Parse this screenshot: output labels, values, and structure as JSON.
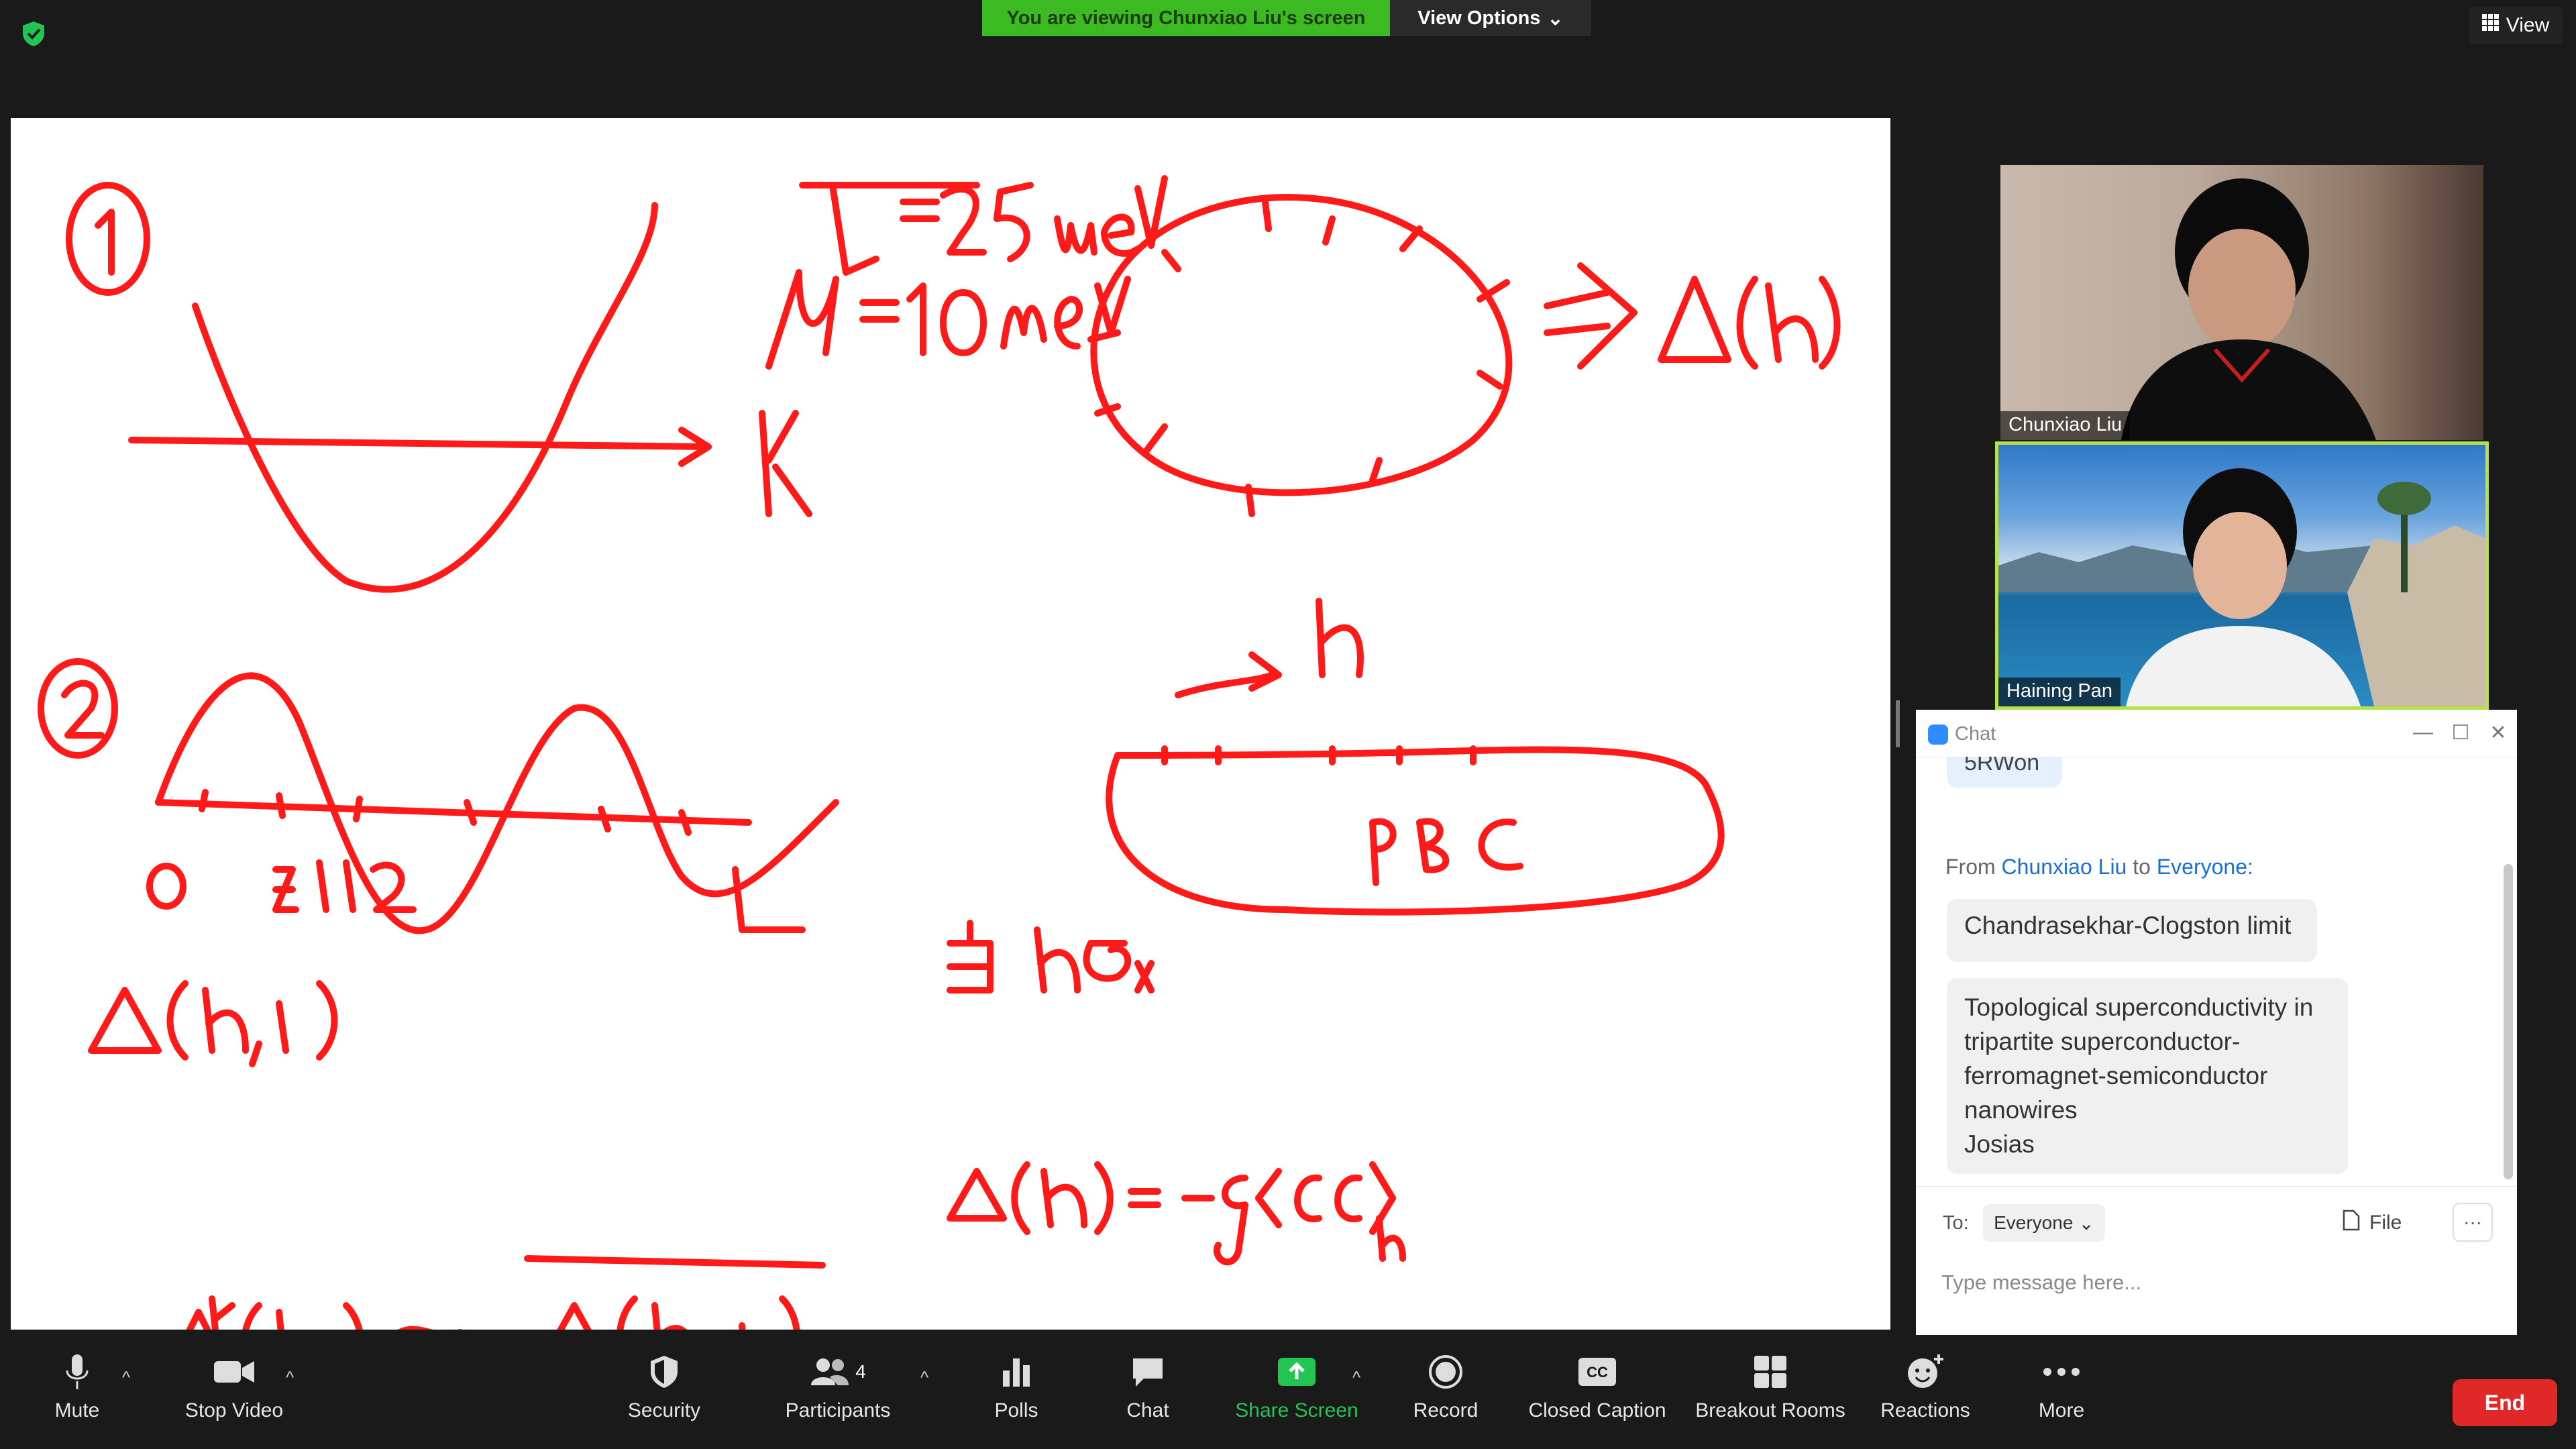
{
  "banner": {
    "viewing_text": "You are viewing Chunxiao Liu's screen",
    "view_options_label": "View Options",
    "view_label": "View"
  },
  "whiteboard": {
    "ink_color": "#ff1a1a",
    "strokes_text": [
      "①",
      "t=25 meV",
      "μ=10 meV",
      "k",
      "⇒ Δ(h)",
      "②",
      "h",
      "PBC",
      "0",
      "i=1",
      "i=2",
      "L",
      "Δ(h,i)",
      "当 hσx",
      "Δ(h)=-g⟨cc⟩h",
      "Δ(h) = Δ(h,i)",
      "k"
    ]
  },
  "participants_video": [
    {
      "name": "Chunxiao Liu"
    },
    {
      "name": "Haining Pan",
      "active_speaker": true
    }
  ],
  "chat": {
    "title": "Chat",
    "prev_bubble": "5RWon",
    "from_prefix": "From",
    "from_name": "Chunxiao Liu",
    "to_word": "to",
    "to_name": "Everyone:",
    "messages": [
      "Chandrasekhar-Clogston limit",
      "Topological superconductivity in tripartite superconductor-ferromagnet-semiconductor nanowires\nJosias"
    ],
    "to_label": "To:",
    "recipient": "Everyone",
    "file_label": "File",
    "input_placeholder": "Type message here..."
  },
  "toolbar": {
    "mute": "Mute",
    "stop_video": "Stop Video",
    "security": "Security",
    "participants": "Participants",
    "participants_count": "4",
    "polls": "Polls",
    "chat": "Chat",
    "share_screen": "Share Screen",
    "record": "Record",
    "closed_caption": "Closed Caption",
    "breakout_rooms": "Breakout Rooms",
    "reactions": "Reactions",
    "more": "More",
    "end": "End"
  },
  "colors": {
    "banner_green": "#3cba21",
    "share_green": "#23c552",
    "end_red": "#e02828",
    "active_speaker_border": "#b7e14a",
    "chat_link": "#1a6ed8"
  }
}
